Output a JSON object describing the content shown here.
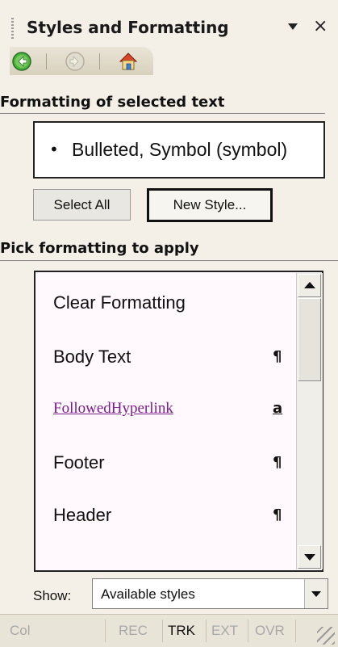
{
  "pane": {
    "title": "Styles and Formatting",
    "menu_icon": "dropdown-arrow-icon",
    "close_label": "×"
  },
  "toolbar": {
    "back_icon": "back-arrow-icon",
    "forward_icon": "forward-arrow-icon",
    "home_icon": "home-icon"
  },
  "selected_section": {
    "heading": "Formatting of selected text",
    "current_format": "Bulleted, Symbol (symbol)",
    "bullet_char": "•"
  },
  "buttons": {
    "select_all": "Select All",
    "new_style": "New Style..."
  },
  "apply_section": {
    "heading": "Pick formatting to apply",
    "items": [
      {
        "label": "Clear Formatting",
        "mark": ""
      },
      {
        "label": "Body Text",
        "mark": "¶"
      },
      {
        "label": "FollowedHyperlink",
        "mark": "a"
      },
      {
        "label": "Footer",
        "mark": "¶"
      },
      {
        "label": "Header",
        "mark": "¶"
      }
    ]
  },
  "show": {
    "label": "Show:",
    "value": "Available styles"
  },
  "statusbar": {
    "col": "Col",
    "rec": "REC",
    "trk": "TRK",
    "ext": "EXT",
    "ovr": "OVR"
  },
  "colors": {
    "panel_bg": "#f4f0e8",
    "list_bg": "#fff8fc",
    "link": "#7b1c8c"
  }
}
